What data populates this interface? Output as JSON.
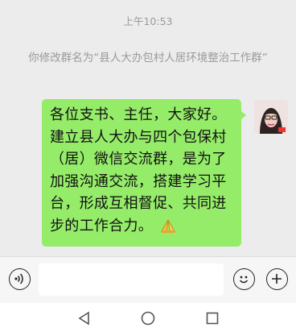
{
  "chat": {
    "timestamp": "上午10:53",
    "system_message": "你修改群名为“县人大办包村人居环境整治工作群”",
    "message": {
      "text": "各位支书、主任，大家好。建立县人大办与四个包保村（居）微信交流群，是为了加强沟通交流，搭建学习平台，形成互相督促、共同进步的工作合力。",
      "emoji": "pray-emoji"
    }
  },
  "input_bar": {
    "voice_icon": "voice-icon",
    "text_value": "",
    "emoji_icon": "smile-icon",
    "plus_icon": "plus-icon"
  },
  "nav_bar": {
    "back_icon": "back-triangle-icon",
    "home_icon": "home-circle-icon",
    "recents_icon": "recents-square-icon"
  },
  "colors": {
    "bubble": "#95ec69",
    "background": "#ececec",
    "system_text": "#9a9a9a"
  }
}
